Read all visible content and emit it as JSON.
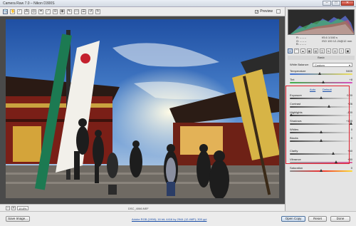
{
  "window": {
    "title": "Camera Raw 7.0  –  Nikon D300S",
    "minimize_label": "–",
    "maximize_label": "□",
    "close_label": "✕"
  },
  "toolbar": {
    "tools": [
      {
        "name": "zoom-tool-icon",
        "glyph": "🔍"
      },
      {
        "name": "hand-tool-icon",
        "glyph": "✋"
      },
      {
        "name": "white-balance-tool-icon",
        "glyph": "⁄"
      },
      {
        "name": "color-sampler-tool-icon",
        "glyph": "⁂"
      },
      {
        "name": "targeted-adjustment-tool-icon",
        "glyph": "◎"
      },
      {
        "name": "crop-tool-icon",
        "glyph": "⌗"
      },
      {
        "name": "straighten-tool-icon",
        "glyph": "⟋"
      },
      {
        "name": "spot-removal-tool-icon",
        "glyph": "⊙"
      },
      {
        "name": "red-eye-tool-icon",
        "glyph": "◉"
      },
      {
        "name": "adjustment-brush-icon",
        "glyph": "✎"
      },
      {
        "name": "graduated-filter-icon",
        "glyph": "▭"
      },
      {
        "name": "preferences-icon",
        "glyph": "☰"
      },
      {
        "name": "rotate-ccw-icon",
        "glyph": "↺"
      },
      {
        "name": "rotate-cw-icon",
        "glyph": "↻"
      }
    ],
    "preview_label": "Preview",
    "preview_checked": "✓"
  },
  "statusbar": {
    "zoom_minus": "–",
    "zoom_plus": "+",
    "zoom_value": "19.8%",
    "filename": "DSC_4066.NEF"
  },
  "footer": {
    "save_label": "Save Image...",
    "workflow_link": "Adobe RGB (1998); 16 bit; 4416 by 2944 (12.4MP); 300 ppi",
    "open_label": "Open Copy",
    "reset_label": "Reset",
    "done_label": "Done"
  },
  "readout": {
    "r_label": "R:",
    "r_value": "– – –",
    "g_label": "G:",
    "g_value": "– – –",
    "b_label": "B:",
    "b_value": "– – –",
    "cam1": "f/5.6    1/160 s",
    "cam2": "ISO 100    12-24@12 mm"
  },
  "section": {
    "title": "Basic"
  },
  "basic": {
    "wb_label": "White Balance:",
    "wb_value": "Custom",
    "temperature_label": "Temperature",
    "temperature_value": "5400",
    "tint_label": "Tint",
    "tint_value": "+8",
    "auto_label": "Auto",
    "default_label": "Default",
    "sliders": [
      {
        "label": "Exposure",
        "value": "0.00",
        "pos": 0.5
      },
      {
        "label": "Contrast",
        "value": "+26",
        "pos": 0.63
      },
      {
        "label": "Highlights",
        "value": "-100",
        "pos": 0.0
      },
      {
        "label": "Shadows",
        "value": "+100",
        "pos": 1.0
      },
      {
        "label": "Whites",
        "value": "0",
        "pos": 0.5
      },
      {
        "label": "Blacks",
        "value": "0",
        "pos": 0.5
      },
      {
        "label": "Clarity",
        "value": "+40",
        "pos": 0.7
      },
      {
        "label": "Vibrance",
        "value": "+50",
        "pos": 0.75
      },
      {
        "label": "Saturation",
        "value": "0",
        "pos": 0.5
      }
    ]
  },
  "photo": {
    "banner_left": "えんむすびの神さま 縁 子 神 社",
    "banner_right": "世界文化遺産登録"
  },
  "colors": {
    "accent_red": "#e11d2c",
    "link_blue": "#1a4ea8"
  }
}
